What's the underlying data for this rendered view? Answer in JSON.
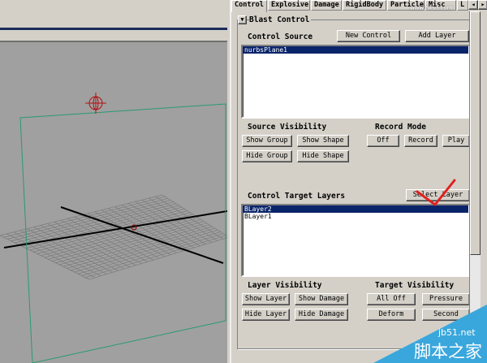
{
  "tabs": [
    "Control",
    "Explosive",
    "Damage",
    "RigidBody",
    "Particle",
    "Misc",
    "L"
  ],
  "group_title": "Blast Control",
  "control_source": {
    "label": "Control Source",
    "new_control": "New Control",
    "add_layer": "Add Layer",
    "items": [
      "nurbsPlane1"
    ]
  },
  "source_visibility": {
    "label": "Source Visibility",
    "show_group": "Show Group",
    "show_shape": "Show Shape",
    "hide_group": "Hide Group",
    "hide_shape": "Hide Shape"
  },
  "record_mode": {
    "label": "Record Mode",
    "off": "Off",
    "record": "Record",
    "play": "Play"
  },
  "target_layers": {
    "label": "Control Target Layers",
    "select_layer": "Select Layer",
    "items": [
      "BLayer2",
      "BLayer1"
    ]
  },
  "layer_visibility": {
    "label": "Layer Visibility",
    "show_layer": "Show Layer",
    "show_damage": "Show Damage",
    "hide_layer": "Hide Layer",
    "hide_damage": "Hide Damage"
  },
  "target_visibility": {
    "label": "Target Visibility",
    "all_off": "All Off",
    "pressure": "Pressure",
    "deform": "Deform",
    "second": "Second"
  },
  "watermarks": {
    "top": "www.hxsd.com",
    "bottom_site": "jb51.net",
    "bottom_name": "脚本之家"
  },
  "colors": {
    "selection": "#0a246a",
    "viewport": "#a0a0a0",
    "plane": "#2a9a70",
    "annotation": "#e02020",
    "watermark": "#3aa7dc"
  }
}
